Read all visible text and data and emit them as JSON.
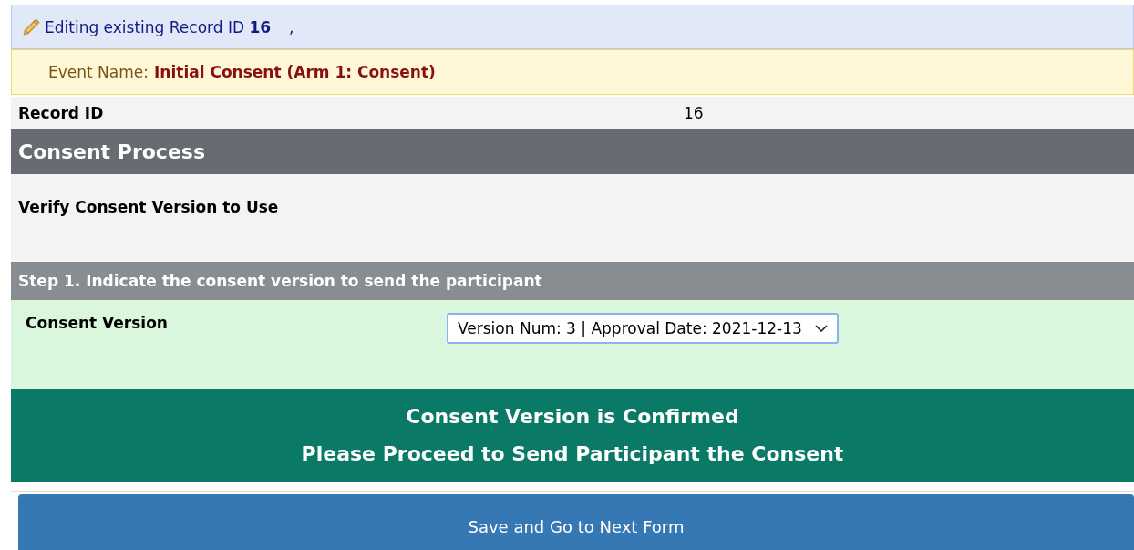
{
  "header": {
    "text": "Editing existing Record ID **16**",
    "suffix": ","
  },
  "event": {
    "label": "Event Name:",
    "value": "Initial Consent (Arm 1: Consent)"
  },
  "record": {
    "label": "Record ID",
    "value": "16"
  },
  "section": {
    "title": "Consent Process"
  },
  "description": "Verify Consent Version to Use",
  "step": {
    "title": "Step 1. Indicate the consent version to send the participant"
  },
  "field": {
    "label": "Consent Version",
    "value": "Version Num: 3 | Approval Date: 2021-12-13"
  },
  "banner": [
    "Consent Version is Confirmed",
    "Please Proceed to Send Participant the Consent"
  ],
  "button": "Save and Go to Next Form"
}
